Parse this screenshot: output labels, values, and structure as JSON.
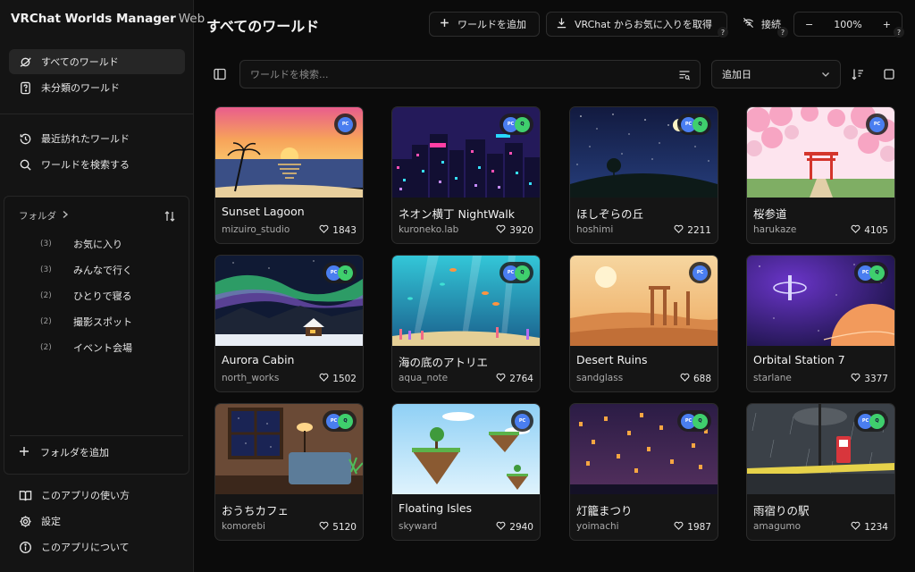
{
  "app": {
    "title": "VRChat Worlds Manager",
    "title_suffix": "Web"
  },
  "sidebar": {
    "nav_top": [
      {
        "label": "すべてのワールド",
        "icon": "planet-icon",
        "active": true
      },
      {
        "label": "未分類のワールド",
        "icon": "file-question-icon",
        "active": false
      }
    ],
    "nav_mid": [
      {
        "label": "最近訪れたワールド",
        "icon": "history-icon"
      },
      {
        "label": "ワールドを検索する",
        "icon": "search-icon"
      }
    ],
    "folders_header": "フォルダ",
    "folders": [
      {
        "count": "(3)",
        "label": "お気に入り"
      },
      {
        "count": "(3)",
        "label": "みんなで行く"
      },
      {
        "count": "(2)",
        "label": "ひとりで寝る"
      },
      {
        "count": "(2)",
        "label": "撮影スポット"
      },
      {
        "count": "(2)",
        "label": "イベント会場"
      }
    ],
    "add_folder": "フォルダを追加",
    "nav_bottom": [
      {
        "label": "このアプリの使い方",
        "icon": "book-icon"
      },
      {
        "label": "設定",
        "icon": "gear-icon"
      },
      {
        "label": "このアプリについて",
        "icon": "info-icon"
      }
    ]
  },
  "header": {
    "page_title": "すべてのワールド",
    "add_world": "ワールドを追加",
    "fetch_favorites": "VRChat からお気に入りを取得",
    "connect": "接続",
    "help_mark": "?",
    "zoom_minus": "−",
    "zoom_level": "100%",
    "zoom_plus": "+"
  },
  "toolbar": {
    "search_placeholder": "ワールドを検索...",
    "sort_label": "追加日"
  },
  "platform_labels": {
    "pc": "PC",
    "quest": "Q"
  },
  "worlds": [
    {
      "name": "Sunset Lagoon",
      "author": "mizuiro_studio",
      "favorites": "1843",
      "platforms": [
        "pc"
      ]
    },
    {
      "name": "ネオン横丁 NightWalk",
      "author": "kuroneko.lab",
      "favorites": "3920",
      "platforms": [
        "pc",
        "quest"
      ]
    },
    {
      "name": "ほしぞらの丘",
      "author": "hoshimi",
      "favorites": "2211",
      "platforms": [
        "pc",
        "quest"
      ]
    },
    {
      "name": "桜参道",
      "author": "harukaze",
      "favorites": "4105",
      "platforms": [
        "pc"
      ]
    },
    {
      "name": "Aurora Cabin",
      "author": "north_works",
      "favorites": "1502",
      "platforms": [
        "pc",
        "quest"
      ]
    },
    {
      "name": "海の底のアトリエ",
      "author": "aqua_note",
      "favorites": "2764",
      "platforms": [
        "pc",
        "quest"
      ]
    },
    {
      "name": "Desert Ruins",
      "author": "sandglass",
      "favorites": "688",
      "platforms": [
        "pc"
      ]
    },
    {
      "name": "Orbital Station 7",
      "author": "starlane",
      "favorites": "3377",
      "platforms": [
        "pc",
        "quest"
      ]
    },
    {
      "name": "おうちカフェ",
      "author": "komorebi",
      "favorites": "5120",
      "platforms": [
        "pc",
        "quest"
      ]
    },
    {
      "name": "Floating Isles",
      "author": "skyward",
      "favorites": "2940",
      "platforms": [
        "pc"
      ]
    },
    {
      "name": "灯籠まつり",
      "author": "yoimachi",
      "favorites": "1987",
      "platforms": [
        "pc",
        "quest"
      ]
    },
    {
      "name": "雨宿りの駅",
      "author": "amagumo",
      "favorites": "1234",
      "platforms": [
        "pc",
        "quest"
      ]
    }
  ]
}
